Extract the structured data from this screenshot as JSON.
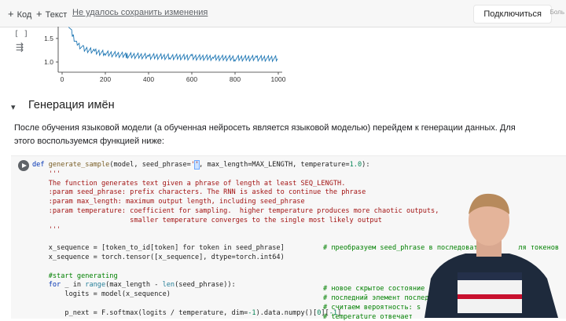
{
  "toolbar": {
    "add_code": "Код",
    "add_text": "Текст",
    "save_status": "Не удалось сохранить изменения",
    "connect_label": "Подключиться",
    "faded_label": "Боль"
  },
  "chart_cell": {
    "gutter": "[ ]",
    "chart_data": {
      "type": "line",
      "x_ticks": [
        0,
        200,
        400,
        600,
        800,
        1000
      ],
      "y_ticks": [
        1.0,
        1.5
      ],
      "xlim": [
        0,
        1000
      ],
      "series": [
        {
          "x": [
            30,
            50,
            70,
            100,
            150,
            200,
            300,
            400,
            500,
            600,
            700,
            800,
            900,
            1000
          ],
          "values": [
            1.8,
            1.55,
            1.38,
            1.28,
            1.22,
            1.18,
            1.14,
            1.12,
            1.11,
            1.1,
            1.09,
            1.08,
            1.08,
            1.07
          ]
        }
      ],
      "color": "#1f77b4"
    }
  },
  "section": {
    "title": "Генерация имён",
    "paragraph": "После обучения языковой модели (а обученная нейросеть является языковой моделью) перейдем к генерации данных. Для этого воспользуемся функцией ниже:"
  },
  "code": {
    "l1_def": "def ",
    "l1_fn": "generate_sample",
    "l1_a": "(model, seed_phrase=",
    "l1_str": "'",
    "l1_cursor": "'",
    "l1_b": ", max_length=MAX_LENGTH, temperature=",
    "l1_num": "1.0",
    "l1_c": "):",
    "doc": "    '''\n    The function generates text given a phrase of length at least SEQ_LENGTH.\n    :param seed_phrase: prefix characters. The RNN is asked to continue the phrase\n    :param max_length: maximum output length, including seed_phrase\n    :param temperature: coefficient for sampling.  higher temperature produces more chaotic outputs,\n                        smaller temperature converges to the single most likely output\n    '''",
    "l10": "    x_sequence = [token_to_id[token] for token in seed_phrase]",
    "l11": "    x_sequence = torch.tensor([x_sequence], dtype=torch.int64)",
    "l13": "    #start generating",
    "l14_for": "    for",
    "l14_rest": " _ in ",
    "l14_range": "range",
    "l14_a": "(max_length - ",
    "l14_len": "len",
    "l14_b": "(seed_phrase)):",
    "l15": "        logits = model(x_sequence)",
    "l17_a": "        p_next = F.softmax(logits / temperature, dim=",
    "l17_num": "-1",
    "l17_b": ").data.numpy()[",
    "l17_n0": "0",
    "l17_c": "][",
    "l17_n1": "-1",
    "l17_d": "]",
    "cm1": "# преобразуем seed_phrase в последоват",
    "cm1_tail": "ля токенов",
    "cm2": "# новое скрытое состояние",
    "cm3": "# последний элемент последо",
    "cm4": "# считаем вероятность: s",
    "cm5": "# temperature отвечает"
  }
}
